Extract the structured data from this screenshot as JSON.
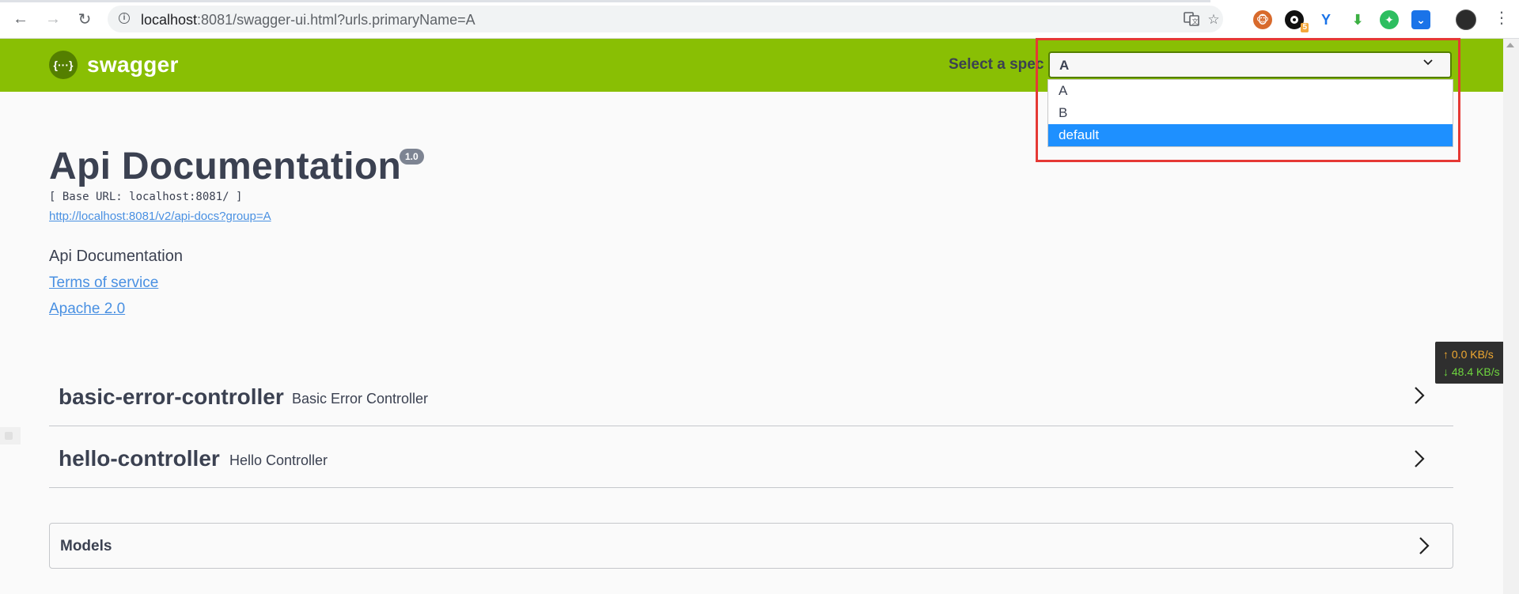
{
  "browser": {
    "url_host": "localhost",
    "url_rest": ":8081/swagger-ui.html?urls.primaryName=A",
    "buttons": {
      "back_icon": "←",
      "forward_icon": "→",
      "reload_icon": "↻"
    },
    "extension_badge": "5"
  },
  "topbar": {
    "logo_symbol": "{···}",
    "logo_text": "swagger",
    "spec_label": "Select a spec",
    "selected_spec": "A",
    "spec_options": [
      "A",
      "B",
      "default"
    ],
    "highlighted_option": "default",
    "brand_color": "#89bf04"
  },
  "info": {
    "title": "Api Documentation",
    "version": "1.0",
    "base_url": "[ Base URL: localhost:8081/ ]",
    "api_docs_link": "http://localhost:8081/v2/api-docs?group=A",
    "description": "Api Documentation",
    "terms_link": "Terms of service",
    "license_link": "Apache 2.0"
  },
  "tags": [
    {
      "name": "basic-error-controller",
      "description": "Basic Error Controller"
    },
    {
      "name": "hello-controller",
      "description": "Hello Controller"
    }
  ],
  "models": {
    "label": "Models"
  },
  "netspeed": {
    "up": "↑ 0.0 KB/s",
    "down": "↓ 48.4 KB/s"
  }
}
